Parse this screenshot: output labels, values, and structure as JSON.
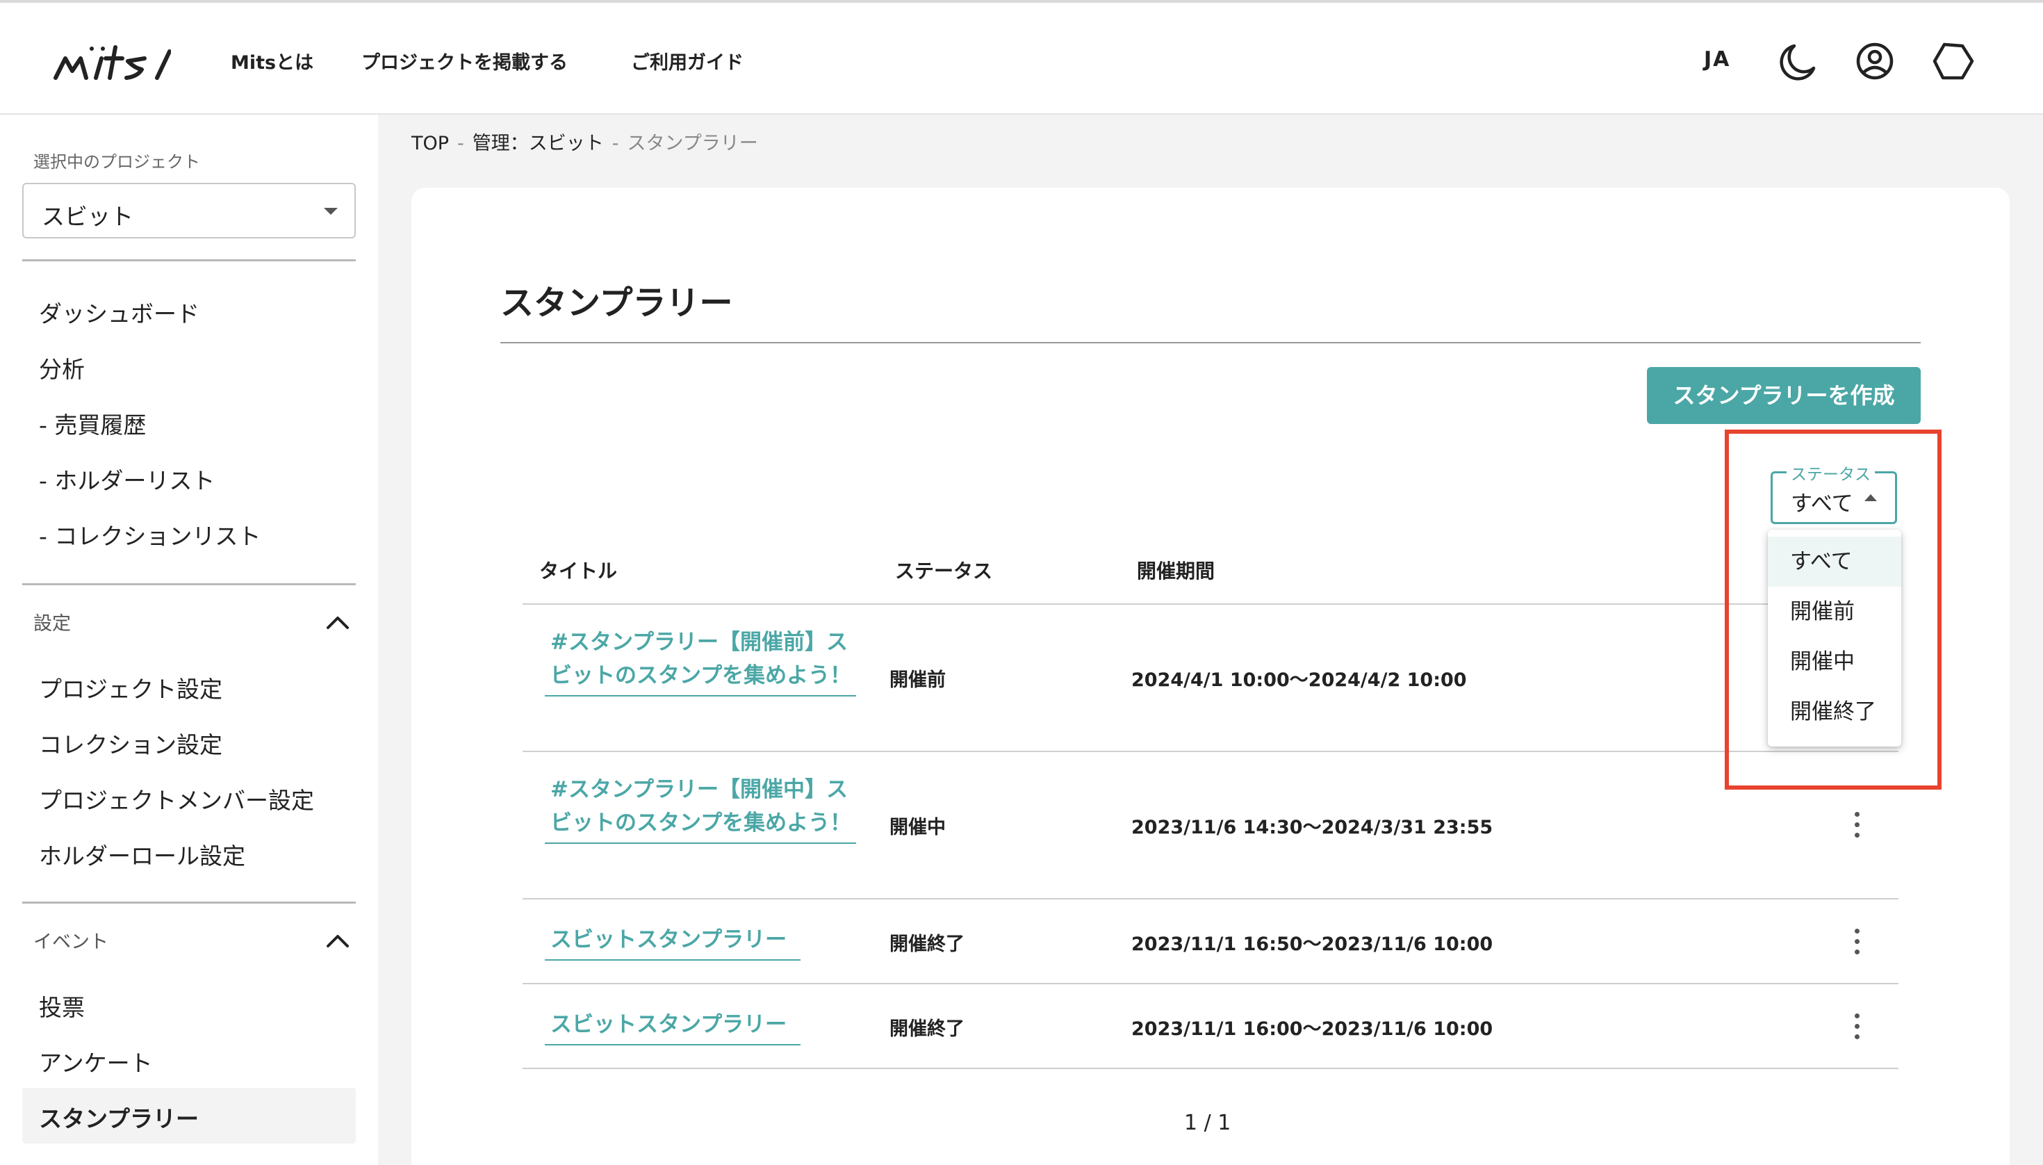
{
  "header": {
    "logo_text": "mits",
    "nav": [
      "Mitsとは",
      "プロジェクトを掲載する",
      "ご利用ガイド"
    ],
    "lang": "JA"
  },
  "sidebar": {
    "project_caption": "選択中のプロジェクト",
    "project_value": "スビット",
    "main_items": [
      "ダッシュボード",
      "分析",
      "- 売買履歴",
      "- ホルダーリスト",
      "- コレクションリスト"
    ],
    "settings_label": "設定",
    "settings_items": [
      "プロジェクト設定",
      "コレクション設定",
      "プロジェクトメンバー設定",
      "ホルダーロール設定"
    ],
    "event_label": "イベント",
    "event_items": [
      "投票",
      "アンケート",
      "スタンプラリー"
    ]
  },
  "breadcrumb": [
    "TOP",
    "管理：スビット",
    "スタンプラリー"
  ],
  "page": {
    "title": "スタンプラリー",
    "create_button": "スタンプラリーを作成"
  },
  "filter": {
    "label": "ステータス",
    "value": "すべて",
    "options": [
      "すべて",
      "開催前",
      "開催中",
      "開催終了"
    ]
  },
  "table": {
    "headers": [
      "タイトル",
      "ステータス",
      "開催期間"
    ],
    "rows": [
      {
        "title": "#スタンプラリー【開催前】スビットのスタンプを集めよう！",
        "status": "開催前",
        "period": "2024/4/1 10:00〜2024/4/2 10:00"
      },
      {
        "title": "#スタンプラリー【開催中】スビットのスタンプを集めよう！",
        "status": "開催中",
        "period": "2023/11/6 14:30〜2024/3/31 23:55"
      },
      {
        "title": "スビットスタンプラリー",
        "status": "開催終了",
        "period": "2023/11/1 16:50〜2023/11/6 10:00"
      },
      {
        "title": "スビットスタンプラリー",
        "status": "開催終了",
        "period": "2023/11/1 16:00〜2023/11/6 10:00"
      }
    ]
  },
  "pagination": "1 / 1",
  "colors": {
    "accent": "#4ba7a6",
    "highlight": "#e8432e"
  },
  "icons": [
    "moon-icon",
    "account-icon",
    "hexagon-icon",
    "chevron-up-icon",
    "more-vert-icon",
    "caret-down-icon"
  ]
}
